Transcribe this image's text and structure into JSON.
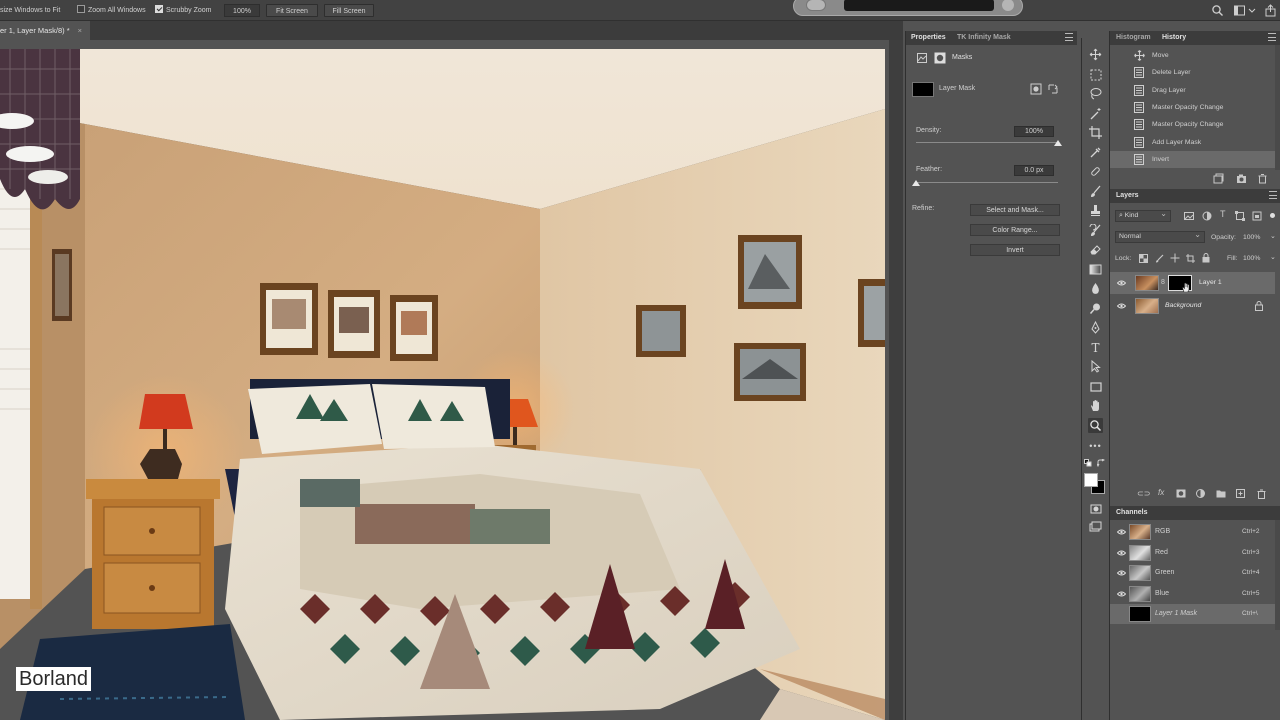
{
  "options_bar": {
    "resize_windows_label": "size Windows to Fit",
    "zoom_all_label": "Zoom All Windows",
    "zoom_all_checked": false,
    "scrubby_zoom_label": "Scrubby Zoom",
    "scrubby_zoom_checked": true,
    "zoom_value": "100%",
    "fit_screen_label": "Fit Screen",
    "fill_screen_label": "Fill Screen"
  },
  "document": {
    "tab_title": "er 1, Layer Mask/8) *",
    "watermark": "Borland"
  },
  "properties": {
    "tabs": [
      "Properties",
      "TK Infinity Mask"
    ],
    "section": "Masks",
    "mask_label": "Layer Mask",
    "density_label": "Density:",
    "density_value": "100%",
    "density_level": 1.0,
    "feather_label": "Feather:",
    "feather_value": "0.0 px",
    "feather_level": 0.0,
    "refine_label": "Refine:",
    "buttons": [
      "Select and Mask...",
      "Color Range...",
      "Invert"
    ]
  },
  "tools": [
    "move-tool-icon",
    "marquee-tool-icon",
    "lasso-tool-icon",
    "magic-wand-icon",
    "crop-tool-icon",
    "eyedropper-icon",
    "healing-brush-icon",
    "brush-tool-icon",
    "clone-stamp-icon",
    "history-brush-icon",
    "eraser-icon",
    "gradient-tool-icon",
    "blur-tool-icon",
    "dodge-tool-icon",
    "pen-tool-icon",
    "type-tool-icon",
    "path-selection-icon",
    "rectangle-tool-icon",
    "hand-tool-icon",
    "zoom-tool-icon",
    "more-tools-icon"
  ],
  "history": {
    "tabs": [
      "Histogram",
      "History"
    ],
    "items": [
      "Move",
      "Delete Layer",
      "Drag Layer",
      "Master Opacity Change",
      "Master Opacity Change",
      "Add Layer Mask",
      "Invert"
    ],
    "selected_index": 6
  },
  "layers": {
    "title": "Layers",
    "filter_label": "Kind",
    "blend_mode": "Normal",
    "opacity_label": "Opacity:",
    "opacity_value": "100%",
    "lock_label": "Lock:",
    "fill_label": "Fill:",
    "fill_value": "100%",
    "items": [
      {
        "name": "Layer 1",
        "has_mask": true
      },
      {
        "name": "Background",
        "locked": true
      }
    ]
  },
  "channels": {
    "title": "Channels",
    "items": [
      {
        "name": "RGB",
        "shortcut": "Ctrl+2"
      },
      {
        "name": "Red",
        "shortcut": "Ctrl+3"
      },
      {
        "name": "Green",
        "shortcut": "Ctrl+4"
      },
      {
        "name": "Blue",
        "shortcut": "Ctrl+5"
      },
      {
        "name": "Layer 1 Mask",
        "shortcut": "Ctrl+\\"
      }
    ]
  },
  "colors": {
    "panel_bg": "#535353",
    "header_bg": "#3c3c3c",
    "selection": "#6a6a6a",
    "foreground": "#ffffff",
    "background": "#000000"
  }
}
